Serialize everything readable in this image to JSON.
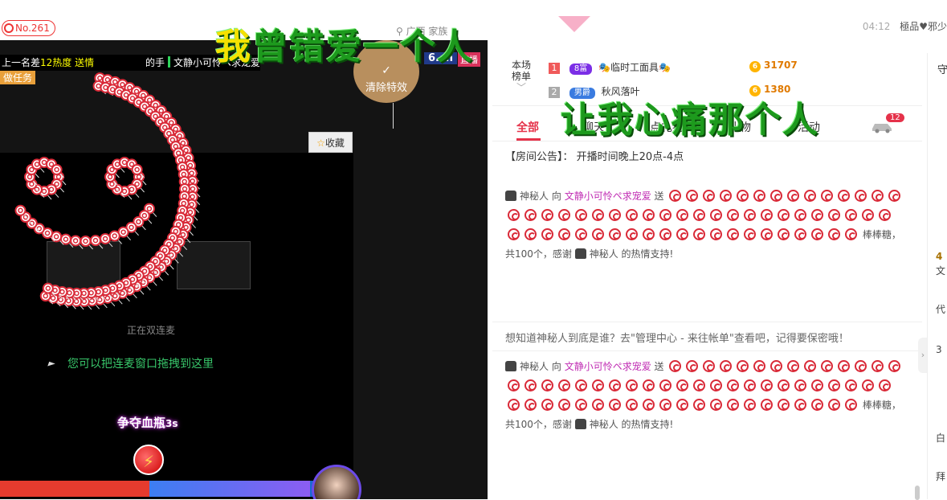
{
  "header": {
    "room_no": "No.261",
    "location": "广西 家族",
    "time": "04:12",
    "user": "極品♥邪少"
  },
  "video": {
    "rank_text_a": "上一名差",
    "rank_hot": "12热度",
    "rank_text_b": "送情",
    "rank_text_c": "的手",
    "host_name": "文静小可怜ペ求宠爱",
    "task_label": "做任务",
    "clear_effects": "清除特效",
    "logo": "6.cn",
    "live": "直播",
    "favorite": "收藏",
    "connect_label": "正在双连麦",
    "drag_hint": "您可以把连麦窗口拖拽到这里",
    "blood_bottle": "争夺血瓶",
    "blood_seconds": "3s"
  },
  "overlay": {
    "line1_yellow": "我",
    "line1_rest": "曾错爱一个人",
    "line2": "让我心痛那个人"
  },
  "ranking": {
    "label_a": "本场",
    "label_b": "榜单",
    "rows": [
      {
        "rank": "1",
        "level": "8富",
        "name": "临时工面具",
        "coins": "31707",
        "color": "#f05a5a"
      },
      {
        "rank": "2",
        "level": "男爵",
        "name": "秋风落叶",
        "coins": "1380",
        "color": "#aaaaaa"
      }
    ]
  },
  "chat": {
    "tabs": [
      "全部",
      "聊天",
      "点礼物",
      "礼物",
      "活动"
    ],
    "badge": "12",
    "notice": "【房间公告】： 开播时间晚上20点-4点",
    "msg1_from": "神秘人",
    "msg1_to_word": "向",
    "msg1_to": "文静小可怜ペ求宠爱",
    "msg1_send": "送",
    "msg1_tail": "棒棒糖，共100个，感谢",
    "msg1_tail2": "神秘人 的热情支持!",
    "hint": "想知道神秘人到底是谁？去\"管理中心 - 来往帐单\"查看吧，记得要保密哦！",
    "msg2_from": "神秘人",
    "msg2_to_word": "向",
    "msg2_to": "文静小可怜ペ求宠爱",
    "msg2_send": "送",
    "msg2_tail": "棒棒糖，共100个，感谢",
    "msg2_tail2": "神秘人 的热情支持!"
  },
  "sidebar": {
    "guard": "守",
    "items": [
      "4",
      "文",
      "代",
      "3",
      "白",
      "拜"
    ]
  }
}
